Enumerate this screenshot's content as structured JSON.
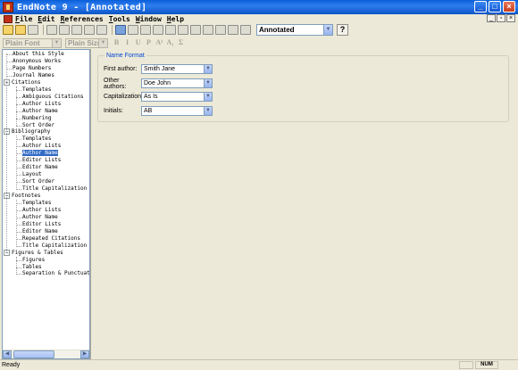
{
  "window": {
    "title": "EndNote 9 - [Annotated]",
    "buttons": [
      "_",
      "□",
      "×"
    ]
  },
  "menu": {
    "items": [
      {
        "key": "F",
        "rest": "ile"
      },
      {
        "key": "E",
        "rest": "dit"
      },
      {
        "key": "R",
        "rest": "eferences"
      },
      {
        "key": "T",
        "rest": "ools"
      },
      {
        "key": "W",
        "rest": "indow"
      },
      {
        "key": "H",
        "rest": "elp"
      }
    ],
    "doc_buttons": [
      "_",
      "▫",
      "×"
    ]
  },
  "toolbar": {
    "style_select": "Annotated",
    "help": "?"
  },
  "format_bar": {
    "font": "Plain Font",
    "size": "Plain Size",
    "buttons": [
      "B",
      "I",
      "U",
      "P",
      "A¹",
      "A₁",
      "Σ"
    ]
  },
  "tree": {
    "items": [
      {
        "label": "About this Style",
        "level": 0,
        "expander": ""
      },
      {
        "label": "Anonymous Works",
        "level": 0,
        "expander": ""
      },
      {
        "label": "Page Numbers",
        "level": 0,
        "expander": ""
      },
      {
        "label": "Journal Names",
        "level": 0,
        "expander": ""
      },
      {
        "label": "Citations",
        "level": 0,
        "expander": "−"
      },
      {
        "label": "Templates",
        "level": 1,
        "expander": ""
      },
      {
        "label": "Ambiguous Citations",
        "level": 1,
        "expander": ""
      },
      {
        "label": "Author Lists",
        "level": 1,
        "expander": ""
      },
      {
        "label": "Author Name",
        "level": 1,
        "expander": ""
      },
      {
        "label": "Numbering",
        "level": 1,
        "expander": ""
      },
      {
        "label": "Sort Order",
        "level": 1,
        "expander": ""
      },
      {
        "label": "Bibliography",
        "level": 0,
        "expander": "−"
      },
      {
        "label": "Templates",
        "level": 1,
        "expander": ""
      },
      {
        "label": "Author Lists",
        "level": 1,
        "expander": ""
      },
      {
        "label": "Author Name",
        "level": 1,
        "expander": "",
        "selected": true
      },
      {
        "label": "Editor Lists",
        "level": 1,
        "expander": ""
      },
      {
        "label": "Editor Name",
        "level": 1,
        "expander": ""
      },
      {
        "label": "Layout",
        "level": 1,
        "expander": ""
      },
      {
        "label": "Sort Order",
        "level": 1,
        "expander": ""
      },
      {
        "label": "Title Capitalization",
        "level": 1,
        "expander": ""
      },
      {
        "label": "Footnotes",
        "level": 0,
        "expander": "−"
      },
      {
        "label": "Templates",
        "level": 1,
        "expander": ""
      },
      {
        "label": "Author Lists",
        "level": 1,
        "expander": ""
      },
      {
        "label": "Author Name",
        "level": 1,
        "expander": ""
      },
      {
        "label": "Editor Lists",
        "level": 1,
        "expander": ""
      },
      {
        "label": "Editor Name",
        "level": 1,
        "expander": ""
      },
      {
        "label": "Repeated Citations",
        "level": 1,
        "expander": ""
      },
      {
        "label": "Title Capitalization",
        "level": 1,
        "expander": ""
      },
      {
        "label": "Figures & Tables",
        "level": 0,
        "expander": "−"
      },
      {
        "label": "Figures",
        "level": 1,
        "expander": ""
      },
      {
        "label": "Tables",
        "level": 1,
        "expander": ""
      },
      {
        "label": "Separation & Punctuati",
        "level": 1,
        "expander": ""
      }
    ]
  },
  "name_format": {
    "title": "Name Format",
    "fields": [
      {
        "label": "First author:",
        "value": "Smith Jane"
      },
      {
        "label": "Other authors:",
        "value": "Doe John"
      },
      {
        "label": "Capitalization:",
        "value": "As Is"
      },
      {
        "label": "Initials:",
        "value": "AB"
      }
    ]
  },
  "status": {
    "text": "Ready",
    "panels": [
      "",
      "NUM"
    ]
  },
  "colors": {
    "title_bar": "#0a5fd8",
    "selection": "#316ac5",
    "group_title": "#0046d5",
    "face": "#ece9d8"
  }
}
